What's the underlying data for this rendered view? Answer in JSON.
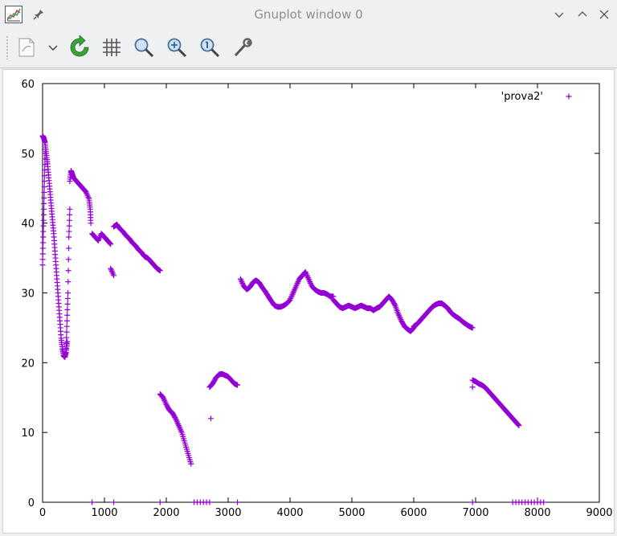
{
  "window": {
    "title": "Gnuplot window 0"
  },
  "toolbar": {
    "items": [
      "export-icon",
      "dropdown-chevron-icon",
      "replot-icon",
      "grid-icon",
      "zoom-out-icon",
      "zoom-in-icon",
      "zoom-previous-icon",
      "settings-icon"
    ]
  },
  "colors": {
    "series": "#9400d3",
    "accent_green": "#2ea043"
  },
  "chart_data": {
    "type": "scatter",
    "title": "",
    "xlabel": "",
    "ylabel": "",
    "xlim": [
      0,
      9000
    ],
    "ylim": [
      0,
      60
    ],
    "xticks": [
      0,
      1000,
      2000,
      3000,
      4000,
      5000,
      6000,
      7000,
      8000,
      9000
    ],
    "yticks": [
      0,
      10,
      20,
      30,
      40,
      50,
      60
    ],
    "marker": "+",
    "legend": {
      "position": "top-right",
      "label": "'prova2'"
    },
    "series": [
      {
        "name": "'prova2'",
        "segments": [
          {
            "x": [
              0,
              20,
              40,
              60,
              80,
              100,
              120,
              140,
              160,
              180,
              200,
              220,
              240,
              260,
              280,
              300,
              320,
              340,
              360,
              380,
              400
            ],
            "y": [
              52.5,
              52.2,
              51.5,
              50.0,
              48.5,
              46.5,
              44.5,
              42.5,
              40.5,
              38.5,
              36.0,
              33.5,
              31.0,
              28.5,
              26.0,
              23.5,
              22.0,
              21.0,
              20.8,
              21.5,
              23.0
            ]
          },
          {
            "x": [
              0,
              10,
              20,
              30,
              40
            ],
            "y": [
              34.0,
              38.0,
              42.0,
              46.0,
              50.0
            ]
          },
          {
            "x": [
              380,
              395,
              410,
              425,
              440
            ],
            "y": [
              22.0,
              26.0,
              30.0,
              38.0,
              42.0
            ]
          },
          {
            "x": [
              440,
              460,
              480,
              500,
              550,
              600,
              650,
              700,
              750,
              770,
              780
            ],
            "y": [
              46.0,
              47.5,
              47.0,
              46.5,
              46.0,
              45.5,
              45.0,
              44.5,
              43.5,
              42.0,
              40.0
            ]
          },
          {
            "x": [
              800,
              850,
              900,
              950,
              1000,
              1050,
              1100
            ],
            "y": [
              38.5,
              38.0,
              37.5,
              38.5,
              38.0,
              37.5,
              37.0
            ]
          },
          {
            "x": [
              1100,
              1150
            ],
            "y": [
              33.5,
              32.5
            ]
          },
          {
            "x": [
              1150,
              1200,
              1250,
              1300,
              1350,
              1400,
              1450,
              1500,
              1550,
              1600,
              1650,
              1700,
              1750,
              1800,
              1850,
              1900
            ],
            "y": [
              39.5,
              39.8,
              39.2,
              38.8,
              38.2,
              37.8,
              37.2,
              36.8,
              36.2,
              35.8,
              35.2,
              35.0,
              34.5,
              34.0,
              33.5,
              33.2
            ]
          },
          {
            "x": [
              1900,
              1950,
              2000,
              2050,
              2100,
              2150,
              2200,
              2250,
              2300,
              2350,
              2400
            ],
            "y": [
              15.5,
              15.0,
              14.0,
              13.2,
              12.8,
              12.0,
              11.0,
              10.0,
              8.5,
              7.0,
              5.5
            ]
          },
          {
            "x": [
              2700,
              2750,
              2800,
              2850,
              2900,
              2950,
              3000,
              3050,
              3100,
              3150
            ],
            "y": [
              16.5,
              17.0,
              17.8,
              18.3,
              18.4,
              18.2,
              18.0,
              17.5,
              17.0,
              16.8
            ]
          },
          {
            "x": [
              2720
            ],
            "y": [
              12.0
            ]
          },
          {
            "x": [
              3200,
              3250,
              3300,
              3350,
              3400,
              3450,
              3500,
              3550,
              3600,
              3650,
              3700,
              3750,
              3800,
              3850,
              3900,
              3950,
              4000,
              4050,
              4100,
              4150,
              4200,
              4250,
              4300,
              4350,
              4400,
              4450,
              4500,
              4550,
              4600,
              4650,
              4700
            ],
            "y": [
              32.0,
              31.0,
              30.5,
              30.8,
              31.5,
              31.8,
              31.5,
              30.8,
              30.2,
              29.5,
              28.8,
              28.2,
              28.0,
              28.0,
              28.2,
              28.5,
              29.0,
              30.0,
              31.0,
              32.0,
              32.5,
              33.0,
              32.0,
              31.0,
              30.5,
              30.2,
              30.0,
              30.0,
              29.8,
              29.5,
              29.5
            ]
          },
          {
            "x": [
              4700,
              4750,
              4800,
              4850,
              4900,
              4950,
              5000,
              5050,
              5100,
              5150,
              5200,
              5250,
              5300,
              5350,
              5400,
              5450,
              5500,
              5550,
              5600,
              5650,
              5700,
              5750,
              5800,
              5850,
              5900,
              5950,
              6000
            ],
            "y": [
              29.0,
              28.5,
              28.0,
              27.8,
              28.0,
              28.2,
              28.0,
              27.8,
              28.0,
              28.2,
              28.0,
              27.8,
              27.8,
              27.5,
              27.8,
              28.0,
              28.5,
              29.0,
              29.5,
              29.0,
              28.2,
              27.0,
              26.0,
              25.2,
              24.8,
              24.5,
              25.0
            ]
          },
          {
            "x": [
              6000,
              6050,
              6100,
              6150,
              6200,
              6250,
              6300,
              6350,
              6400,
              6450,
              6500,
              6550,
              6600,
              6650,
              6700,
              6750,
              6800,
              6850,
              6900,
              6950
            ],
            "y": [
              25.2,
              25.5,
              26.0,
              26.5,
              27.0,
              27.5,
              28.0,
              28.3,
              28.5,
              28.5,
              28.2,
              27.8,
              27.2,
              26.8,
              26.5,
              26.2,
              25.8,
              25.5,
              25.2,
              25.0
            ]
          },
          {
            "x": [
              6950,
              7000,
              7050,
              7100,
              7150,
              7200,
              7250,
              7300,
              7350,
              7400,
              7450,
              7500,
              7550,
              7600,
              7650,
              7700
            ],
            "y": [
              17.5,
              17.3,
              17.0,
              16.8,
              16.5,
              16.0,
              15.5,
              15.0,
              14.5,
              14.0,
              13.5,
              13.0,
              12.5,
              12.0,
              11.5,
              11.0
            ]
          },
          {
            "x": [
              6950
            ],
            "y": [
              16.5
            ]
          },
          {
            "x": [
              800,
              1150,
              1900,
              2450,
              2500,
              2550,
              2600,
              2650,
              2700,
              3150,
              6950,
              7600,
              7650,
              7700,
              7750,
              7800,
              7850,
              7900,
              7950,
              8000,
              8050,
              8100
            ],
            "y": [
              0,
              0,
              0,
              0,
              0,
              0,
              0,
              0,
              0,
              0,
              0,
              0,
              0,
              0,
              0,
              0,
              0,
              0,
              0,
              0,
              0,
              0
            ]
          }
        ]
      }
    ]
  }
}
